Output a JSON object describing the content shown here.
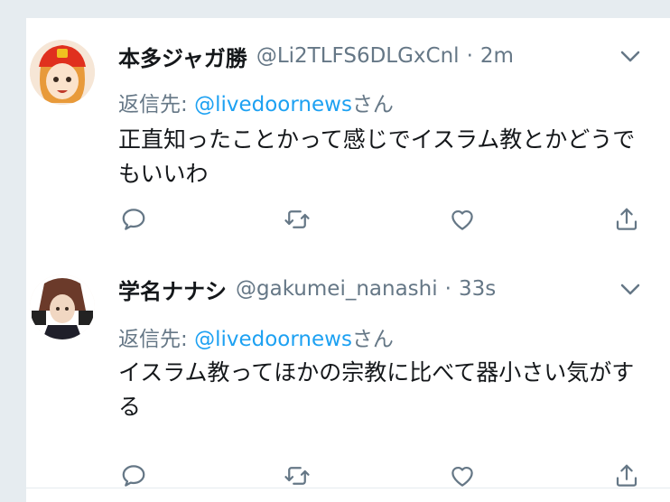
{
  "tweets": [
    {
      "display_name": "本多ジャガ勝",
      "handle": "@Li2TLFS6DLGxCnl",
      "separator": "·",
      "time": "2m",
      "reply_prefix": "返信先: ",
      "reply_mention": "@livedoornews",
      "reply_suffix": "さん",
      "text": "正直知ったことかって感じでイスラム教とかどうでもいいわ"
    },
    {
      "display_name": "学名ナナシ",
      "handle": "@gakumei_nanashi",
      "separator": "·",
      "time": "33s",
      "reply_prefix": "返信先: ",
      "reply_mention": "@livedoornews",
      "reply_suffix": "さん",
      "text": "イスラム教ってほかの宗教に比べて器小さい気がする"
    }
  ],
  "icons": [
    "chevron-down-icon",
    "reply-icon",
    "retweet-icon",
    "like-icon",
    "share-icon"
  ],
  "colors": {
    "link": "#1da1f2",
    "secondary": "#657786",
    "primary_text": "#14171a"
  }
}
